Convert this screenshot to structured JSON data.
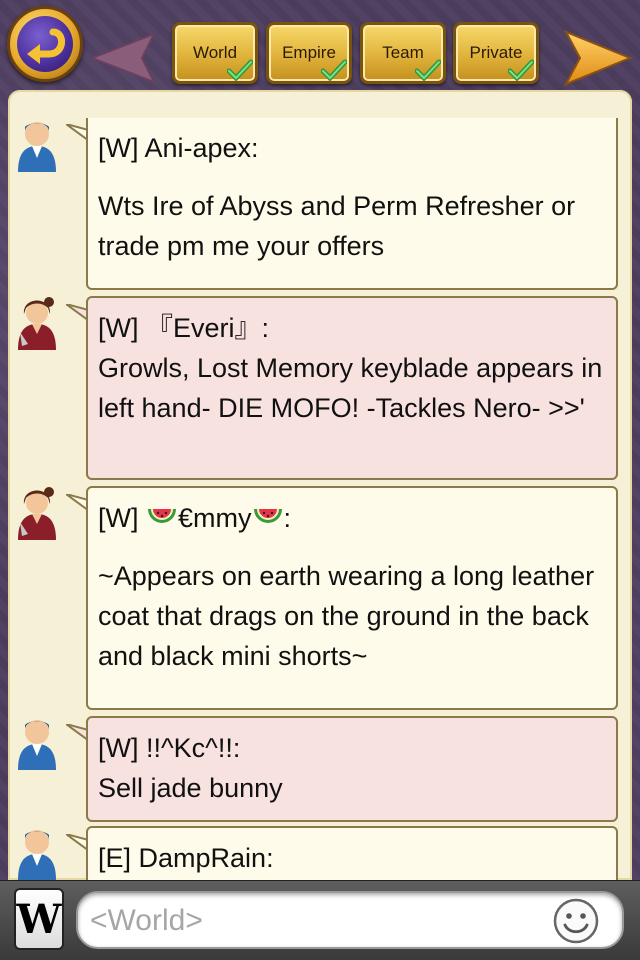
{
  "tabs": [
    {
      "label": "World",
      "checked": true
    },
    {
      "label": "Empire",
      "checked": true
    },
    {
      "label": "Team",
      "checked": true
    },
    {
      "label": "Private",
      "checked": true
    }
  ],
  "messages": [
    {
      "sender": "[W] Ani-apex:",
      "text": "Wts Ire of Abyss and Perm Refresher or trade pm me your offers",
      "avatar": "male-blue-avatar",
      "style": "cream"
    },
    {
      "sender": "[W] 『Everi』:",
      "text": "Growls, Lost Memory keyblade appears in left hand- DIE MOFO! -Tackles Nero- >>'",
      "avatar": "female-red-avatar",
      "style": "pink"
    },
    {
      "sender_prefix": "[W]",
      "sender_name": "€mmy",
      "sender_suffix": ":",
      "text": "~Appears on earth wearing a long leather coat that drags on the ground in the back and black mini shorts~",
      "avatar": "female-red-avatar",
      "style": "cream"
    },
    {
      "sender": "[W] !!^Kc^!!:",
      "text": "Sell jade bunny",
      "avatar": "male-blue-avatar",
      "style": "pink"
    },
    {
      "sender": "[E] DampRain:",
      "text": "",
      "avatar": "male-blue-avatar",
      "style": "cream"
    }
  ],
  "input": {
    "channel_button": "W",
    "placeholder": "<World>"
  },
  "colors": {
    "tab_gold": "#e0b33b",
    "bubble_cream": "#fffbea",
    "bubble_pink": "#f7e2e0",
    "check_green": "#3bb54a"
  }
}
